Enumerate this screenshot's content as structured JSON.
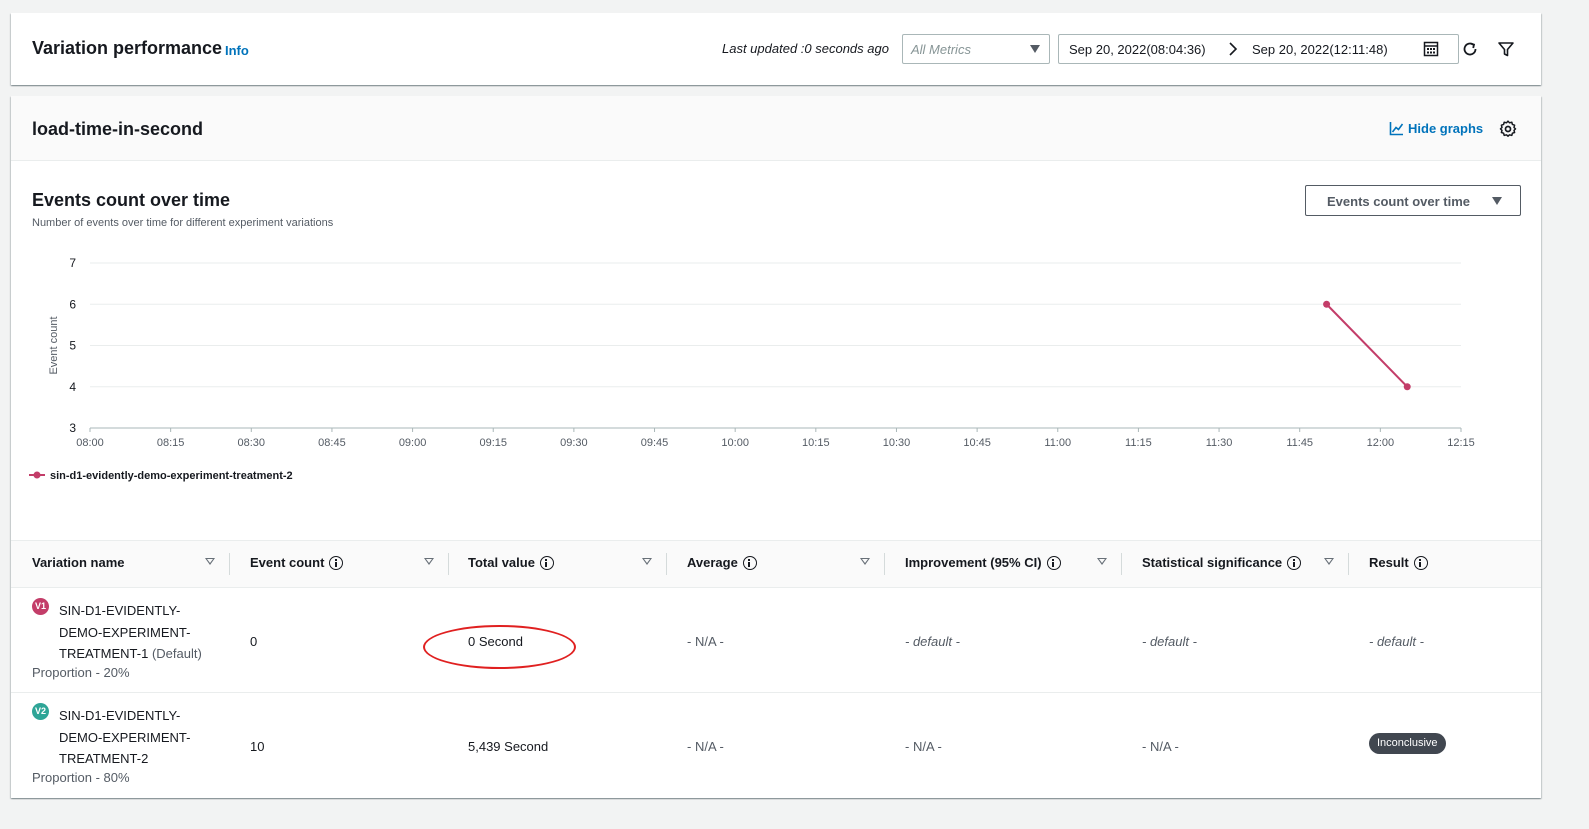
{
  "header": {
    "title": "Variation performance",
    "info_label": "Info",
    "last_updated": "Last updated :0 seconds ago",
    "metrics_placeholder": "All Metrics",
    "date_start": "Sep 20, 2022(08:04:36)",
    "date_end": "Sep 20, 2022(12:11:48)"
  },
  "section": {
    "title": "load-time-in-second",
    "hide_graphs_label": "Hide graphs"
  },
  "chart_panel": {
    "title": "Events count over time",
    "subtitle": "Number of events over time for different experiment variations",
    "selector_label": "Events count over time"
  },
  "chart_data": {
    "type": "line",
    "ylabel": "Event count",
    "xlabel": "",
    "ylim": [
      3,
      7
    ],
    "yticks": [
      "3",
      "4",
      "5",
      "6",
      "7"
    ],
    "xticks": [
      "08:00",
      "08:15",
      "08:30",
      "08:45",
      "09:00",
      "09:15",
      "09:30",
      "09:45",
      "10:00",
      "10:15",
      "10:30",
      "10:45",
      "11:00",
      "11:15",
      "11:30",
      "11:45",
      "12:00",
      "12:15"
    ],
    "grid": true,
    "legend_position": "bottom-left",
    "series": [
      {
        "name": "sin-d1-evidently-demo-experiment-treatment-2",
        "color": "#c33d69",
        "points": [
          {
            "x": "11:50",
            "y": 6
          },
          {
            "x": "12:05",
            "y": 4
          }
        ]
      }
    ]
  },
  "table": {
    "columns": [
      "Variation name",
      "Event count",
      "Total value",
      "Average",
      "Improvement (95% CI)",
      "Statistical significance",
      "Result"
    ],
    "rows": [
      {
        "badge": "V1",
        "badge_color": "#c33d69",
        "name_lines": [
          "SIN-D1-EVIDENTLY-",
          "DEMO-EXPERIMENT-",
          "TREATMENT-1"
        ],
        "default_tag": "(Default)",
        "proportion": "Proportion - 20%",
        "event_count": "0",
        "total_value": "0 Second",
        "average": "- N/A -",
        "improvement": "- default -",
        "significance": "- default -",
        "result": "- default -"
      },
      {
        "badge": "V2",
        "badge_color": "#2ea597",
        "name_lines": [
          "SIN-D1-EVIDENTLY-",
          "DEMO-EXPERIMENT-",
          "TREATMENT-2"
        ],
        "default_tag": "",
        "proportion": "Proportion - 80%",
        "event_count": "10",
        "total_value": "5,439 Second",
        "average": "- N/A -",
        "improvement": "- N/A -",
        "significance": "- N/A -",
        "result": "Inconclusive"
      }
    ]
  },
  "colors": {
    "link": "#0073bb",
    "annotation_oval": "#e02020",
    "result_pill": "#414750"
  }
}
